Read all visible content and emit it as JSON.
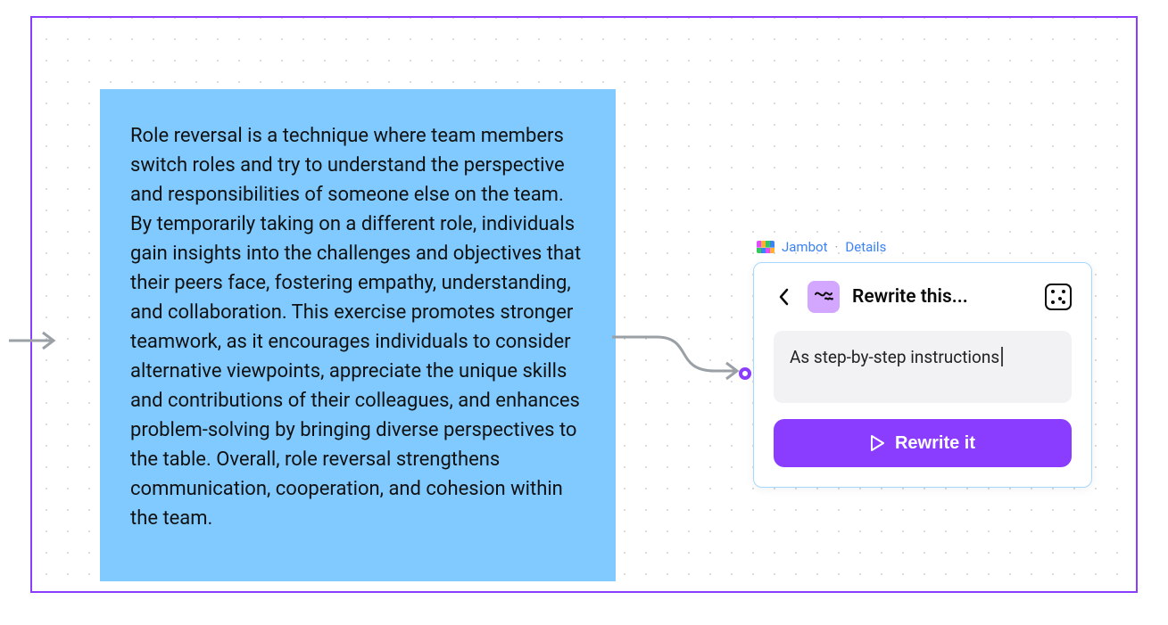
{
  "colors": {
    "accent": "#8b3dff",
    "sticky_bg": "#80caff",
    "link": "#3b82f6",
    "card_border": "#a5d8ff",
    "input_bg": "#f2f2f4"
  },
  "sticky": {
    "text": "Role reversal is a technique where team members switch roles and try to understand the perspective and responsibilities of someone else on the team. By temporarily taking on a different role, individuals gain insights into the challenges and objectives that their peers face, fostering empathy, understanding, and collaboration. This exercise promotes stronger teamwork, as it encourages individuals to consider alternative viewpoints, appreciate the unique skills and contributions of their colleagues, and enhances problem-solving by bringing diverse perspectives to the table. Overall, role reversal strengthens communication, cooperation, and cohesion within the team."
  },
  "widget": {
    "plugin_name": "Jambot",
    "details_label": "Details",
    "separator": "·",
    "title": "Rewrite this...",
    "icon": "squiggle-icon",
    "back_icon": "chevron-left-icon",
    "randomize_icon": "dice-icon",
    "prompt_value": "As step-by-step instructions",
    "prompt_placeholder": "",
    "cta_label": "Rewrite it",
    "cta_icon": "play-icon"
  }
}
